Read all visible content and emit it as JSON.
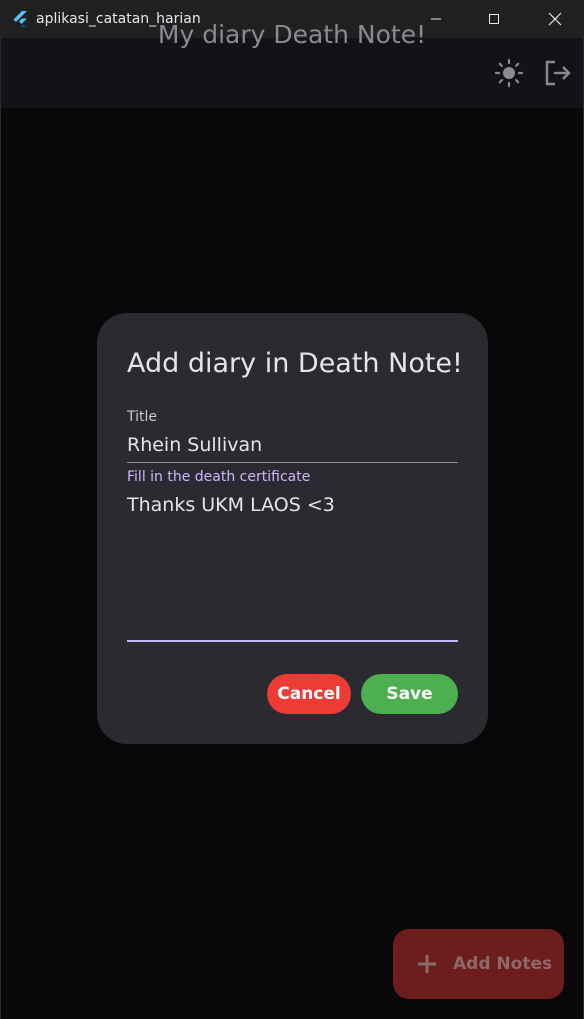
{
  "window": {
    "title": "aplikasi_catatan_harian",
    "icons": {
      "logo": "flutter-logo-icon",
      "minimize": "minimize-icon",
      "maximize": "maximize-icon",
      "close": "close-icon"
    }
  },
  "appbar": {
    "title": "My diary Death Note!",
    "actions": [
      {
        "name": "theme-toggle",
        "icon": "sun-icon"
      },
      {
        "name": "logout",
        "icon": "logout-icon"
      }
    ]
  },
  "dialog": {
    "title": "Add diary in Death Note!",
    "title_field": {
      "label": "Title",
      "value": "Rhein Sullivan"
    },
    "content_field": {
      "label": "Fill in the death certificate",
      "value": "Thanks UKM LAOS <3"
    },
    "cancel_label": "Cancel",
    "save_label": "Save",
    "colors": {
      "cancel": "#ef3b36",
      "save": "#4caf50",
      "focus": "#c7b4f5",
      "background": "#2b2a31"
    }
  },
  "fab": {
    "label": "Add Notes",
    "icon": "plus-icon",
    "color": "#6e1d1d"
  }
}
